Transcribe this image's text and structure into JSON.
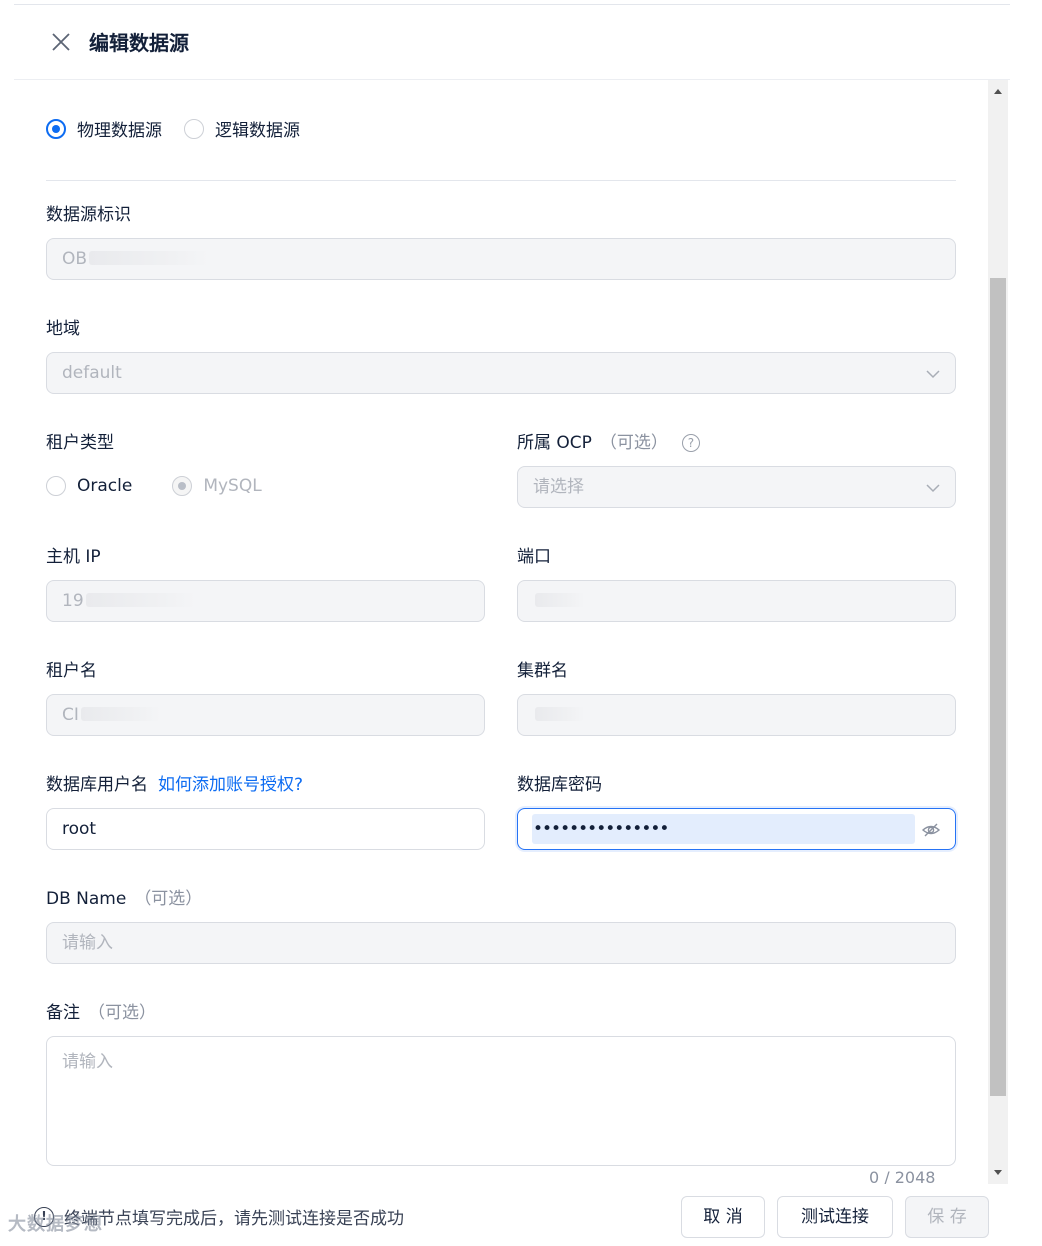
{
  "header": {
    "title": "编辑数据源"
  },
  "source_type": {
    "options": [
      "物理数据源",
      "逻辑数据源"
    ],
    "selected": "物理数据源"
  },
  "fields": {
    "source_id": {
      "label": "数据源标识",
      "value": "OB"
    },
    "region": {
      "label": "地域",
      "value": "default"
    },
    "tenant_type": {
      "label": "租户类型",
      "options": [
        "Oracle",
        "MySQL"
      ],
      "selected": "MySQL"
    },
    "ocp": {
      "label": "所属 OCP",
      "optional": "（可选）",
      "help": "?",
      "placeholder": "请选择"
    },
    "host_ip": {
      "label": "主机 IP",
      "value": "19"
    },
    "port": {
      "label": "端口",
      "value": ""
    },
    "tenant_name": {
      "label": "租户名",
      "value": "CI"
    },
    "cluster_name": {
      "label": "集群名",
      "value": ""
    },
    "db_user": {
      "label": "数据库用户名",
      "help_link": "如何添加账号授权?",
      "value": "root"
    },
    "db_password": {
      "label": "数据库密码",
      "value": "•••••••••••••••"
    },
    "db_name": {
      "label": "DB Name",
      "optional": "（可选）",
      "placeholder": "请输入"
    },
    "remark": {
      "label": "备注",
      "optional": "（可选）",
      "placeholder": "请输入",
      "counter": "0 / 2048"
    }
  },
  "footer": {
    "tip_icon": "!",
    "tip": "终端节点填写完成后，请先测试连接是否成功",
    "cancel": "取 消",
    "test": "测试连接",
    "save": "保 存"
  },
  "watermark": "大数据梦想",
  "colors": {
    "primary": "#0d6cf2",
    "text": "#132039",
    "disabled_bg": "#f4f5f7"
  }
}
